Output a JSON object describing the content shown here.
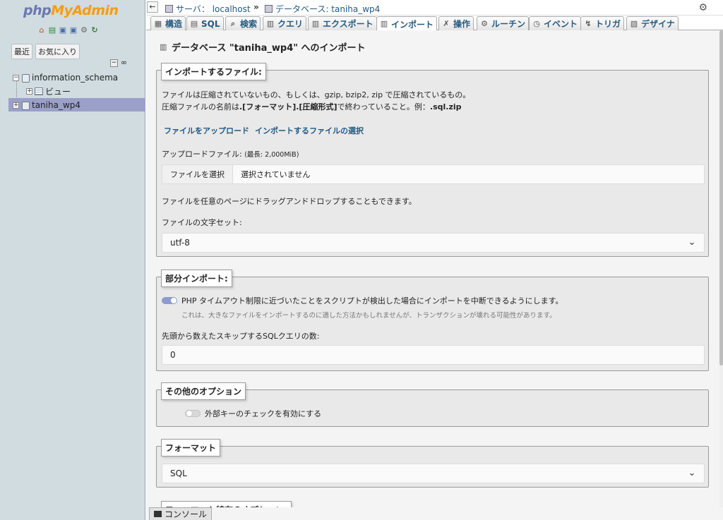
{
  "nav": {
    "logo_php": "php",
    "logo_myadmin": "MyAdmin",
    "icons": [
      "home-icon",
      "log-icon",
      "docs-icon",
      "sql-docs-icon",
      "settings-icon",
      "reload-icon"
    ],
    "tab_recent": "最近",
    "tab_favorites": "お気に入り",
    "tree": [
      {
        "label": "information_schema",
        "expander": "−"
      },
      {
        "label": "ビュー",
        "expander": "+"
      },
      {
        "label": "taniha_wp4",
        "expander": "+",
        "selected": true
      }
    ]
  },
  "breadcrumb": {
    "back": "←",
    "server": "サーバ： localhost",
    "separator": "»",
    "database": "データベース: taniha_wp4"
  },
  "menu": {
    "tabs": [
      {
        "label": "構造",
        "icon": "structure-icon"
      },
      {
        "label": "SQL",
        "icon": "sql-icon"
      },
      {
        "label": "検索",
        "icon": "search-icon"
      },
      {
        "label": "クエリ",
        "icon": "query-icon"
      },
      {
        "label": "エクスポート",
        "icon": "export-icon"
      },
      {
        "label": "インポート",
        "icon": "import-icon",
        "active": true
      },
      {
        "label": "操作",
        "icon": "operations-icon"
      },
      {
        "label": "ルーチン",
        "icon": "routines-icon"
      },
      {
        "label": "イベント",
        "icon": "events-icon"
      },
      {
        "label": "トリガ",
        "icon": "triggers-icon"
      },
      {
        "label": "デザイナ",
        "icon": "designer-icon"
      }
    ]
  },
  "page": {
    "title": "データベース \"taniha_wp4\" へのインポート"
  },
  "file_section": {
    "legend": "インポートするファイル:",
    "line1": "ファイルは圧縮されていないもの、もしくは、gzip, bzip2, zip で圧縮されているもの。",
    "line2_prefix": "圧縮ファイルの名前は",
    "line2_bold": ".[フォーマット].[圧縮形式]",
    "line2_mid": "で終わっていること。例：",
    "line2_example": ".sql.zip",
    "upload_link": "ファイルをアップロード",
    "select_link": "インポートするファイルの選択",
    "upload_label": "アップロードファイル:",
    "upload_max": "(最長: 2,000MiB)",
    "file_button": "ファイルを選択",
    "file_status": "選択されていません",
    "drag_drop": "ファイルを任意のページにドラッグアンドドロップすることもできます。",
    "charset_label": "ファイルの文字セット:",
    "charset_value": "utf-8"
  },
  "partial_section": {
    "legend": "部分インポート:",
    "allow_interrupt": "PHP タイムアウト制限に近づいたことをスクリプトが検出した場合にインポートを中断できるようにします。",
    "allow_interrupt_note": "これは、大きなファイルをインポートするのに適した方法かもしれませんが、トランザクションが壊れる可能性があります。",
    "skip_label": "先頭から数えたスキップするSQLクエリの数:",
    "skip_value": "0"
  },
  "other_section": {
    "legend": "その他のオプション",
    "fk_checks": "外部キーのチェックを有効にする"
  },
  "format_section": {
    "legend": "フォーマット",
    "value": "SQL"
  },
  "format_options_section": {
    "legend": "フォーマット特有のオプション:"
  },
  "console": {
    "label": "コンソール"
  }
}
